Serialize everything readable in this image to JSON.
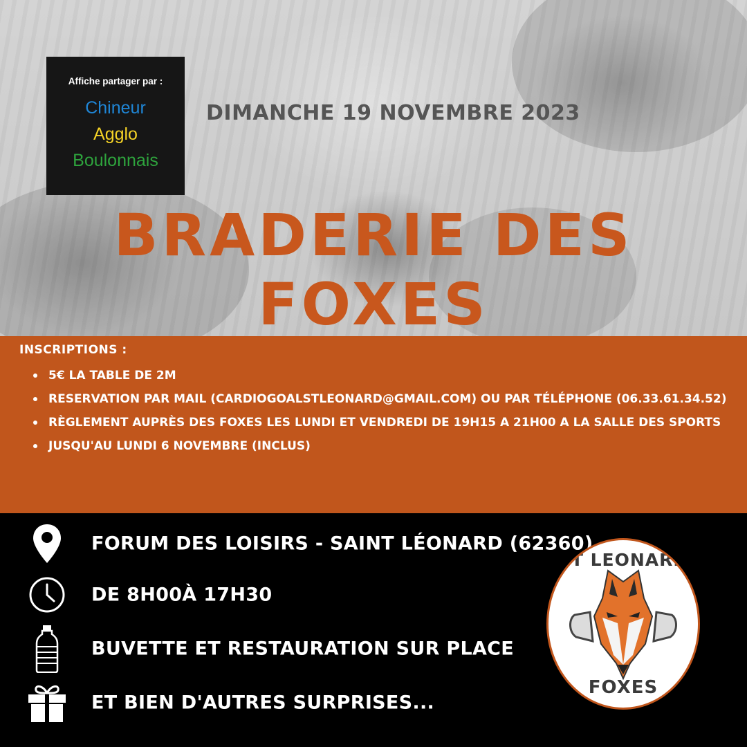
{
  "share_badge": {
    "title": "Affiche partager par :",
    "line1": "Chineur",
    "line2": "Agglo",
    "line3": "Boulonnais",
    "colors": {
      "line1": "#1f86d6",
      "line2": "#f5d326",
      "line3": "#2ea43d"
    }
  },
  "event": {
    "date": "DIMANCHE 19 NOVEMBRE 2023",
    "title": "BRADERIE DES FOXES"
  },
  "inscriptions": {
    "heading": "INSCRIPTIONS :",
    "items": [
      "5€ LA TABLE DE 2M",
      "RESERVATION PAR MAIL (CARDIOGOALSTLEONARD@GMAIL.COM) OU PAR TÉLÉPHONE (06.33.61.34.52)",
      "RÈGLEMENT AUPRÈS DES FOXES LES LUNDI ET VENDREDI DE 19H15 A 21H00 A LA SALLE DES SPORTS",
      "JUSQU'AU LUNDI 6 NOVEMBRE (INCLUS)"
    ]
  },
  "details": [
    {
      "icon": "location-pin-icon",
      "text": "FORUM DES LOISIRS - SAINT LÉONARD (62360)"
    },
    {
      "icon": "clock-icon",
      "text": "DE 8H00À 17H30"
    },
    {
      "icon": "water-bottle-icon",
      "text": "BUVETTE ET RESTAURATION SUR PLACE"
    },
    {
      "icon": "gift-icon",
      "text": "ET BIEN D'AUTRES SURPRISES..."
    }
  ],
  "logo": {
    "top_text": "ST LEONARD",
    "bottom_text": "FOXES"
  },
  "colors": {
    "accent_orange": "#c1561c",
    "title_orange": "#c8571d",
    "date_gray": "#555555",
    "background_black": "#000000"
  }
}
